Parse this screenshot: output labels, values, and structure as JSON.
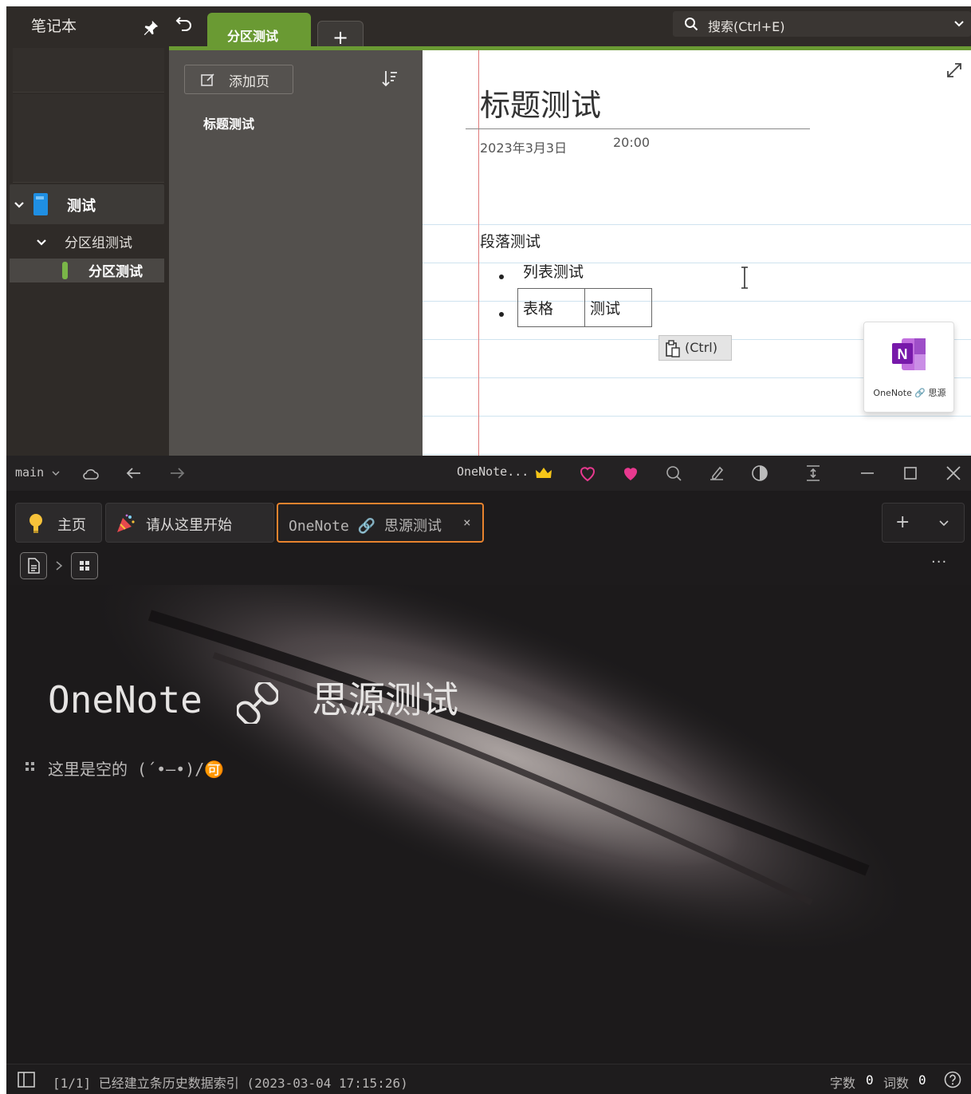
{
  "onenote": {
    "notebook_header": "笔记本",
    "tab_active": "分区测试",
    "tab_add": "+",
    "search_label": "搜索(Ctrl+E)",
    "notebook": {
      "name": "测试",
      "section_group": "分区组测试",
      "section": "分区测试",
      "color": "#1f8fe3"
    },
    "add_page_label": "添加页",
    "pages": [
      "标题测试"
    ],
    "note": {
      "title": "标题测试",
      "date": "2023年3月3日",
      "time": "20:00",
      "paragraph": "段落测试",
      "list_item": "列表测试",
      "table": [
        [
          "表格",
          "测试"
        ]
      ],
      "paste_options": "(Ctrl)"
    },
    "clip_card_label": "OneNote 🔗 思源",
    "accent": "#6a9a33"
  },
  "siyuan": {
    "branch": "main",
    "window_title": "OneNote...",
    "tabs": [
      {
        "label": "主页",
        "icon": "lightbulb-icon"
      },
      {
        "label": "请从这里开始",
        "icon": "party-popper-icon"
      },
      {
        "label": "OneNote 🔗 思源测试",
        "icon": "link-icon",
        "active": true
      }
    ],
    "tab_close": "×",
    "tab_actions": {
      "add": "+",
      "more": "⌄"
    },
    "more_menu": "···",
    "doc": {
      "title_en": "OneNote",
      "title_zh": "思源测试",
      "empty_text": "这里是空的 (´•—•)/🉑"
    },
    "status": {
      "index_message": "[1/1] 已经建立条历史数据索引 (2023-03-04 17:15:26)",
      "char_count_label": "字数",
      "char_count": "0",
      "word_count_label": "词数",
      "word_count": "0"
    },
    "accent": "#e8832e",
    "heart_color": "#e8398f",
    "crown_color": "#f5c518"
  }
}
